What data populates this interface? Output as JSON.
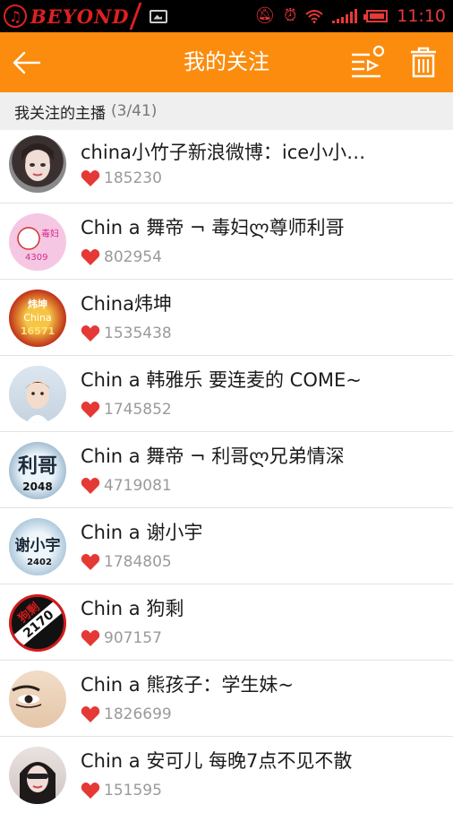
{
  "status_bar": {
    "brand": "BEYOND",
    "time": "11:10",
    "icons": [
      "music-note-icon",
      "gallery-icon",
      "mute-icon",
      "alarm-icon",
      "wifi-icon",
      "signal-icon",
      "battery-icon"
    ],
    "accent_color": "#e83838"
  },
  "app_bar": {
    "title": "我的关注",
    "back_icon": "arrow-left-icon",
    "list_icon": "playlist-icon",
    "delete_icon": "trash-icon",
    "color": "#fb8c0e"
  },
  "section": {
    "title": "我关注的主播",
    "count": "(3/41)"
  },
  "followed": [
    {
      "name": "china小竹子新浪微博：ice小小…",
      "count": "185230",
      "avatar": "photo-avatar-girl"
    },
    {
      "name": "Chin a 舞帝 ¬ 毒妇ლ尊师利哥",
      "count": "802954",
      "avatar_text": "毒妇 4309"
    },
    {
      "name": "China炜坤",
      "count": "1535438",
      "avatar_text": "炜坤 China 16571"
    },
    {
      "name": "Chin a 韩雅乐 要连麦的 COME~",
      "count": "1745852",
      "avatar": "photo-avatar-boy"
    },
    {
      "name": "Chin a 舞帝 ¬ 利哥ლ兄弟情深",
      "count": "4719081",
      "avatar_text": "利哥 2048"
    },
    {
      "name": "Chin a 谢小宇",
      "count": "1784805",
      "avatar_text": "谢小宇 2402"
    },
    {
      "name": "Chin a 狗剩",
      "count": "907157",
      "avatar_text": "狗剩 2170"
    },
    {
      "name": "Chin a 熊孩子：学生妹~",
      "count": "1826699",
      "avatar": "photo-avatar-eyes"
    },
    {
      "name": "Chin a 安可儿 每晚7点不见不散",
      "count": "151595",
      "avatar": "photo-avatar-girl2"
    }
  ]
}
